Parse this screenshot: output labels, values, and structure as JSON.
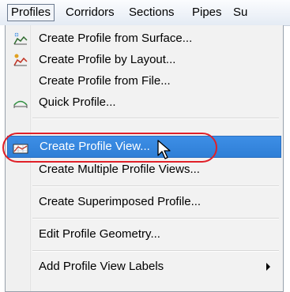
{
  "menubar": {
    "items": [
      "Profiles",
      "Corridors",
      "Sections",
      "Pipes",
      "Su"
    ]
  },
  "menu": {
    "items": [
      {
        "label": "Create Profile from Surface...",
        "icon": "profile-from-surface-icon"
      },
      {
        "label": "Create Profile by Layout...",
        "icon": "profile-by-layout-icon"
      },
      {
        "label": "Create Profile from File...",
        "icon": ""
      },
      {
        "label": "Quick Profile...",
        "icon": "quick-profile-icon"
      },
      {
        "label": "Create Profile View...",
        "icon": "profile-view-icon",
        "highlighted": true
      },
      {
        "label": "Create Multiple Profile Views...",
        "icon": ""
      },
      {
        "label": "Create Superimposed Profile...",
        "icon": ""
      },
      {
        "label": "Edit Profile Geometry...",
        "icon": ""
      },
      {
        "label": "Add Profile View Labels",
        "icon": "",
        "submenu": true
      }
    ]
  },
  "colors": {
    "highlight": "#3587e0",
    "annotation_ring": "#e02028"
  }
}
